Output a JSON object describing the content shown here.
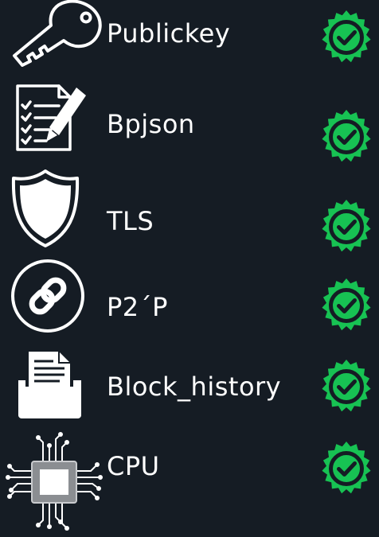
{
  "colors": {
    "background": "#151c24",
    "badge": "#17c253",
    "text": "#ffffff"
  },
  "items": [
    {
      "label": "Publickey",
      "icon": "key-icon",
      "status": "check-badge"
    },
    {
      "label": "Bpjson",
      "icon": "checklist-document-icon",
      "status": "check-badge"
    },
    {
      "label": "TLS",
      "icon": "shield-icon",
      "status": "check-badge"
    },
    {
      "label": "P2´P",
      "icon": "chain-link-icon",
      "status": "check-badge"
    },
    {
      "label": "Block_history",
      "icon": "file-folder-icon",
      "status": "check-badge"
    },
    {
      "label": "CPU",
      "icon": "cpu-chip-icon",
      "status": "check-badge"
    }
  ]
}
